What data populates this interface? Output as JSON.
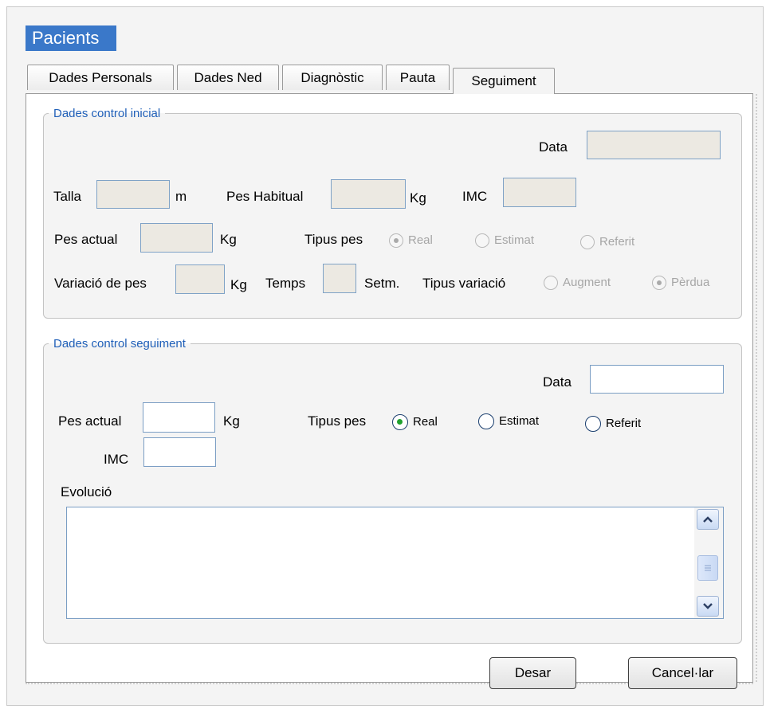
{
  "window": {
    "title": "Pacients"
  },
  "tabs": [
    {
      "label": "Dades Personals"
    },
    {
      "label": "Dades Ned"
    },
    {
      "label": "Diagnòstic"
    },
    {
      "label": "Pauta"
    },
    {
      "label": "Seguiment",
      "active": true
    }
  ],
  "initial": {
    "legend": "Dades control inicial",
    "data_label": "Data",
    "talla_label": "Talla",
    "talla_unit": "m",
    "pes_habitual_label": "Pes Habitual",
    "pes_habitual_unit": "Kg",
    "imc_label": "IMC",
    "pes_actual_label": "Pes actual",
    "pes_actual_unit": "Kg",
    "tipus_pes_label": "Tipus pes",
    "tipus_pes_options": [
      "Real",
      "Estimat",
      "Referit"
    ],
    "tipus_pes_selected": "Real",
    "variacio_label": "Variació de pes",
    "variacio_unit": "Kg",
    "temps_label": "Temps",
    "temps_unit": "Setm.",
    "tipus_variacio_label": "Tipus variació",
    "tipus_variacio_options": [
      "Augment",
      "Pèrdua"
    ],
    "tipus_variacio_selected": "Pèrdua"
  },
  "followup": {
    "legend": "Dades control seguiment",
    "data_label": "Data",
    "pes_actual_label": "Pes actual",
    "pes_actual_unit": "Kg",
    "tipus_pes_label": "Tipus pes",
    "tipus_pes_options": [
      "Real",
      "Estimat",
      "Referit"
    ],
    "tipus_pes_selected": "Real",
    "imc_label": "IMC",
    "evolucio_label": "Evolució"
  },
  "buttons": {
    "save": "Desar",
    "cancel": "Cancel·lar"
  },
  "colors": {
    "title_bg": "#3a78c9",
    "legend": "#1f5fb8",
    "radio_selected": "#1fa12e"
  }
}
